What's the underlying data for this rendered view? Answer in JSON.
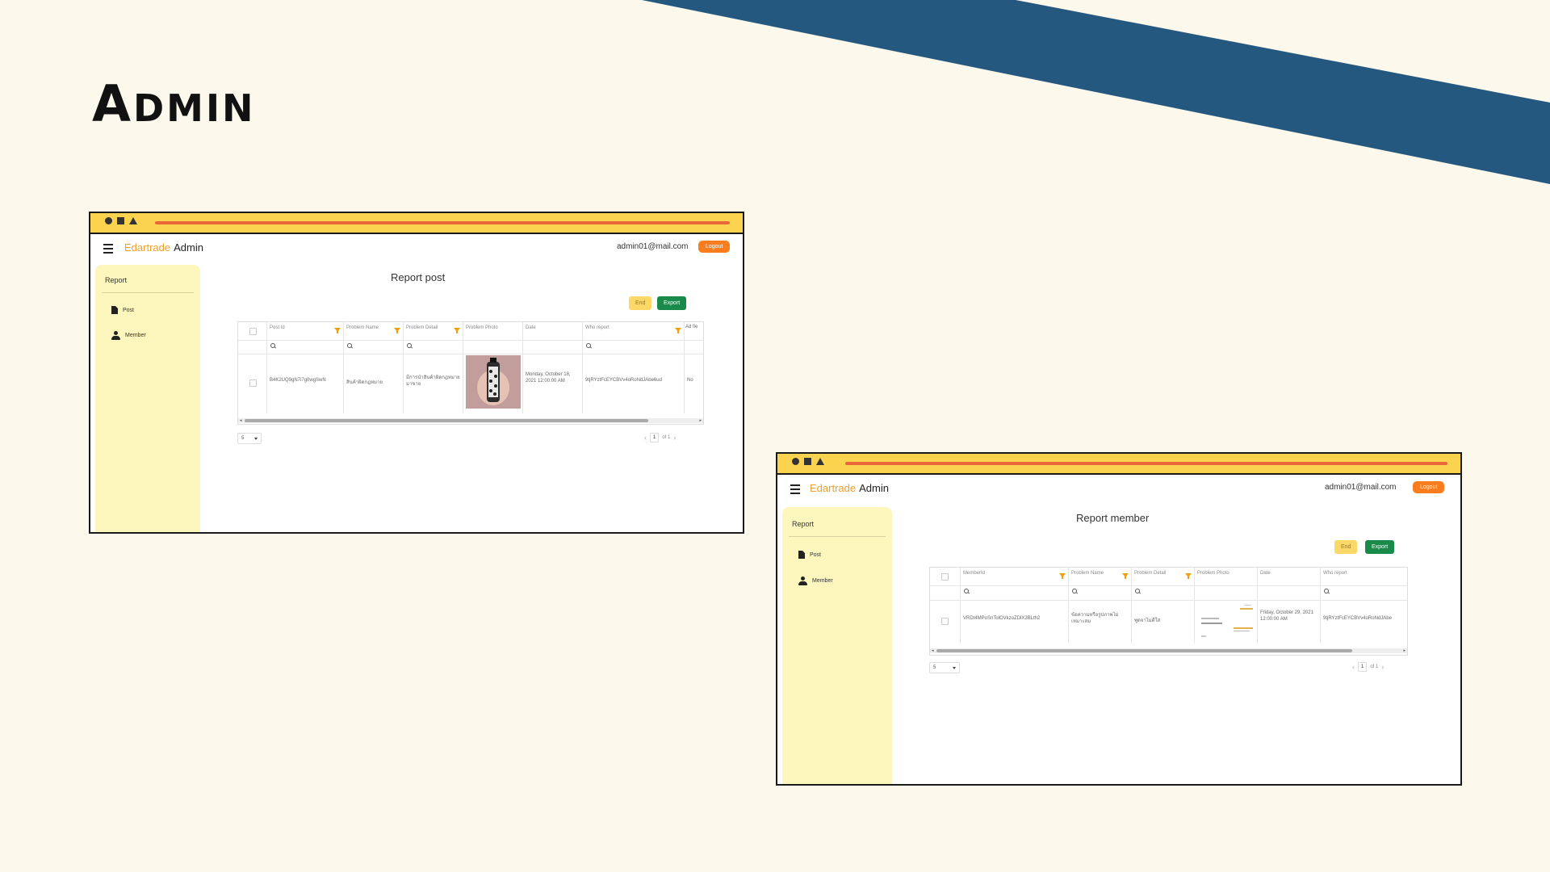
{
  "slide": {
    "title_first": "A",
    "title_rest": "DMIN",
    "colors": {
      "background": "#fcf8ec",
      "stripe": "#25587f",
      "titlebar": "#fbd34e",
      "sidebar": "#fdf6bd",
      "brand": "#f0a12a",
      "logout": "#f97d1e",
      "export": "#1a8a4a"
    }
  },
  "app": {
    "brand_name": "Edartrade",
    "brand_suffix": "Admin",
    "user_email": "admin01@mail.com",
    "logout_label": "Logout",
    "menu_icon": "hamburger-icon",
    "sidebar": {
      "title": "Report",
      "items": [
        {
          "label": "Post",
          "icon": "document-icon"
        },
        {
          "label": "Member",
          "icon": "person-icon"
        }
      ]
    },
    "end_label": "End",
    "export_label": "Export"
  },
  "report_post": {
    "heading": "Report post",
    "columns": [
      "Post Id",
      "Problem Name",
      "Problem Detail",
      "Problem Photo",
      "Date",
      "Who report",
      "Ad fie"
    ],
    "row": {
      "post_id": "B4K2UQ9gN7i7g0wgSwN",
      "problem_name": "สินค้าผิดกฎหมาย",
      "problem_detail": "มีการนำสินค้าผิดกฎหมายมาขาย",
      "date": "Monday, October 18, 2021 12:00:00 AM",
      "who_report": "9tjRYztFcEYCBVv4oRoNdJAbe6ud",
      "extra": "No"
    },
    "page_size": "5",
    "page_current": "1",
    "page_of": "of 1"
  },
  "report_member": {
    "heading": "Report member",
    "columns": [
      "MemberId",
      "Problem Name",
      "Problem Detail",
      "Problem Photo",
      "Date",
      "Who report"
    ],
    "row": {
      "member_id": "VRDt4MPoSnTolOVkzoZDlX3BLth2",
      "problem_name": "ข้อความหรือรูปภาพไม่เหมาะสม",
      "problem_detail": "พูดจาไม่ดีใส่",
      "date": "Friday, October 29, 2021 12:00:00 AM",
      "who_report": "9tjRYztFcEYCBVv4oRoNdJAbe"
    },
    "page_size": "5",
    "page_current": "1",
    "page_of": "of 1"
  }
}
